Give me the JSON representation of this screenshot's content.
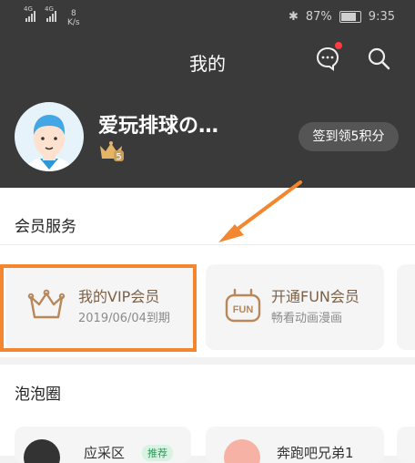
{
  "statusbar": {
    "signal1_label": "4G",
    "signal2_label": "4G",
    "net_speed_value": "8",
    "net_speed_unit": "K/s",
    "battery_percent": "87%",
    "time": "9:35"
  },
  "header": {
    "title": "我的",
    "username": "爱玩排球の…",
    "vip_level": "5",
    "signin_label": "签到领5积分"
  },
  "sections": {
    "member_title": "会员服务",
    "bubble_title": "泡泡圈"
  },
  "cards": [
    {
      "title": "我的VIP会员",
      "subtitle": "2019/06/04到期",
      "icon": "crown-icon"
    },
    {
      "title": "开通FUN会员",
      "subtitle": "畅看动画漫画",
      "icon": "fun-icon"
    }
  ],
  "bubble_cards": [
    {
      "name": "应采区",
      "tag": "推荐"
    },
    {
      "name": "奔跑吧兄弟1"
    }
  ],
  "colors": {
    "header_bg": "#3a3a3a",
    "highlight": "#f3862e",
    "gold": "#c9a26b",
    "notification": "#ff3b3b"
  }
}
